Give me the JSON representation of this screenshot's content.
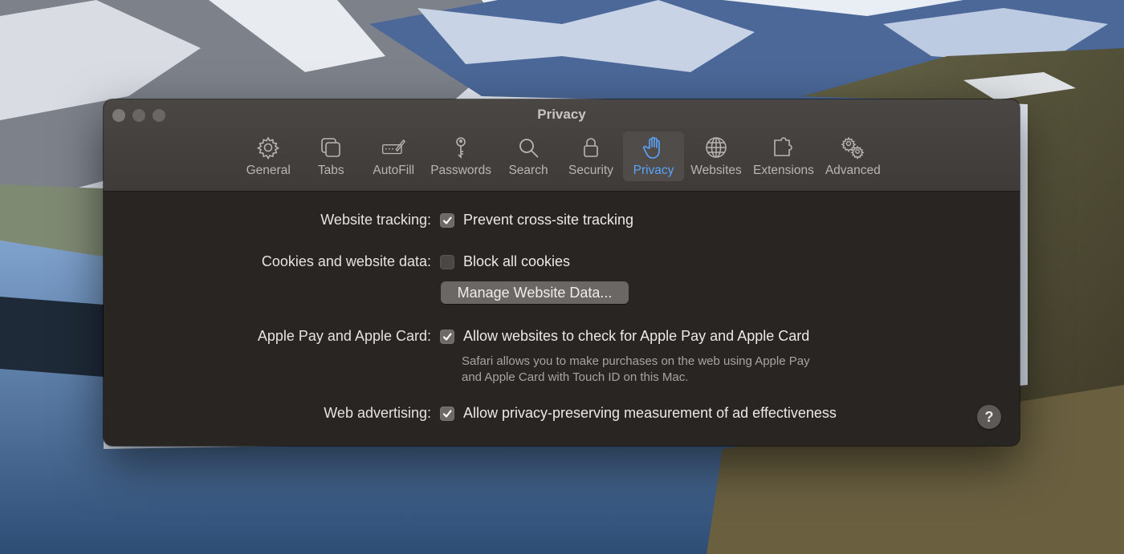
{
  "window": {
    "title": "Privacy"
  },
  "toolbar": {
    "tabs": [
      {
        "label": "General",
        "icon": "gear-icon"
      },
      {
        "label": "Tabs",
        "icon": "tabs-icon"
      },
      {
        "label": "AutoFill",
        "icon": "autofill-icon"
      },
      {
        "label": "Passwords",
        "icon": "key-icon"
      },
      {
        "label": "Search",
        "icon": "search-icon"
      },
      {
        "label": "Security",
        "icon": "lock-icon"
      },
      {
        "label": "Privacy",
        "icon": "hand-icon",
        "active": true
      },
      {
        "label": "Websites",
        "icon": "globe-icon"
      },
      {
        "label": "Extensions",
        "icon": "puzzle-icon"
      },
      {
        "label": "Advanced",
        "icon": "gears-icon"
      }
    ]
  },
  "settings": {
    "tracking": {
      "label": "Website tracking:",
      "option": "Prevent cross-site tracking",
      "checked": true
    },
    "cookies": {
      "label": "Cookies and website data:",
      "option": "Block all cookies",
      "checked": false,
      "button": "Manage Website Data..."
    },
    "applepay": {
      "label": "Apple Pay and Apple Card:",
      "option": "Allow websites to check for Apple Pay and Apple Card",
      "checked": true,
      "note_line1": "Safari allows you to make purchases on the web using Apple Pay",
      "note_line2": "and Apple Card with Touch ID on this Mac."
    },
    "advertising": {
      "label": "Web advertising:",
      "option": "Allow privacy-preserving measurement of ad effectiveness",
      "checked": true
    }
  },
  "help": {
    "label": "?"
  },
  "colors": {
    "accent": "#5ba4ff",
    "window_bg": "#292523",
    "toolbar_bg": "#45413f"
  }
}
